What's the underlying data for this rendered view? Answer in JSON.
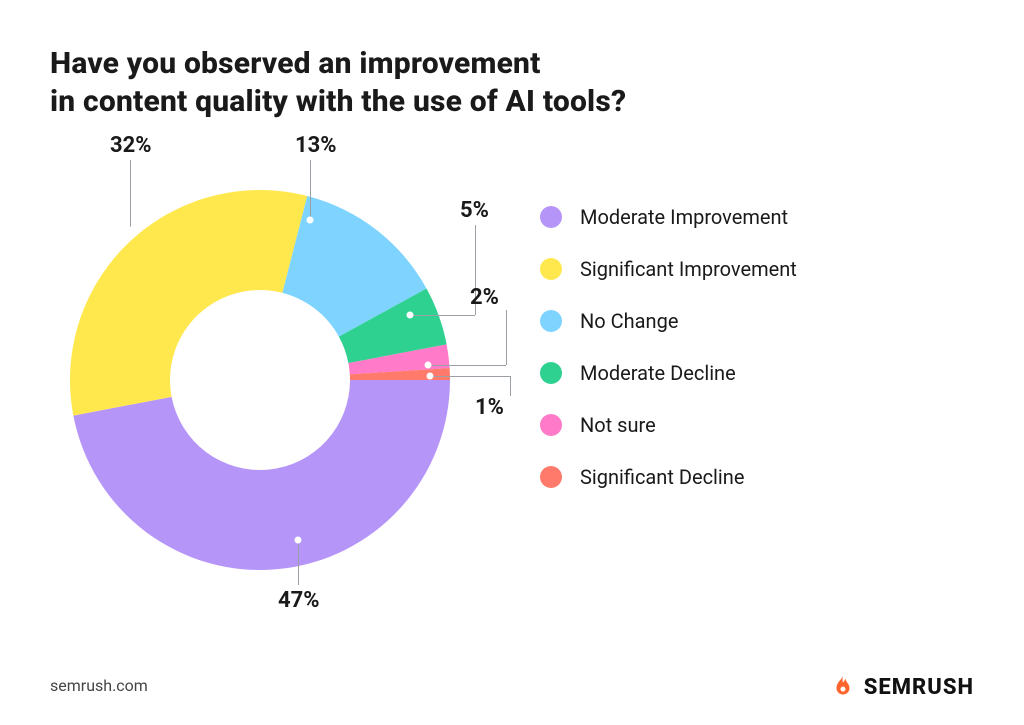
{
  "title_line1": "Have you observed an improvement",
  "title_line2": "in content quality with the use of AI tools?",
  "legend": {
    "items": [
      {
        "label": "Moderate Improvement",
        "color": "#b695f9"
      },
      {
        "label": "Significant Improvement",
        "color": "#ffe84d"
      },
      {
        "label": "No Change",
        "color": "#7fd4ff"
      },
      {
        "label": "Moderate Decline",
        "color": "#2fd191"
      },
      {
        "label": "Not sure",
        "color": "#ff7ac8"
      },
      {
        "label": "Significant Decline",
        "color": "#ff7a6b"
      }
    ]
  },
  "callouts": {
    "moderate_improvement": "47%",
    "significant_improvement": "32%",
    "no_change": "13%",
    "moderate_decline": "5%",
    "not_sure": "2%",
    "significant_decline": "1%"
  },
  "footer": "semrush.com",
  "brand": "SEMRUSH",
  "chart_data": {
    "type": "pie",
    "title": "Have you observed an improvement in content quality with the use of AI tools?",
    "series": [
      {
        "name": "Moderate Improvement",
        "value": 47,
        "color": "#b695f9"
      },
      {
        "name": "Significant Improvement",
        "value": 32,
        "color": "#ffe84d"
      },
      {
        "name": "No Change",
        "value": 13,
        "color": "#7fd4ff"
      },
      {
        "name": "Moderate Decline",
        "value": 5,
        "color": "#2fd191"
      },
      {
        "name": "Not sure",
        "value": 2,
        "color": "#ff7ac8"
      },
      {
        "name": "Significant Decline",
        "value": 1,
        "color": "#ff7a6b"
      }
    ],
    "units": "percent",
    "hole": 0.45
  }
}
